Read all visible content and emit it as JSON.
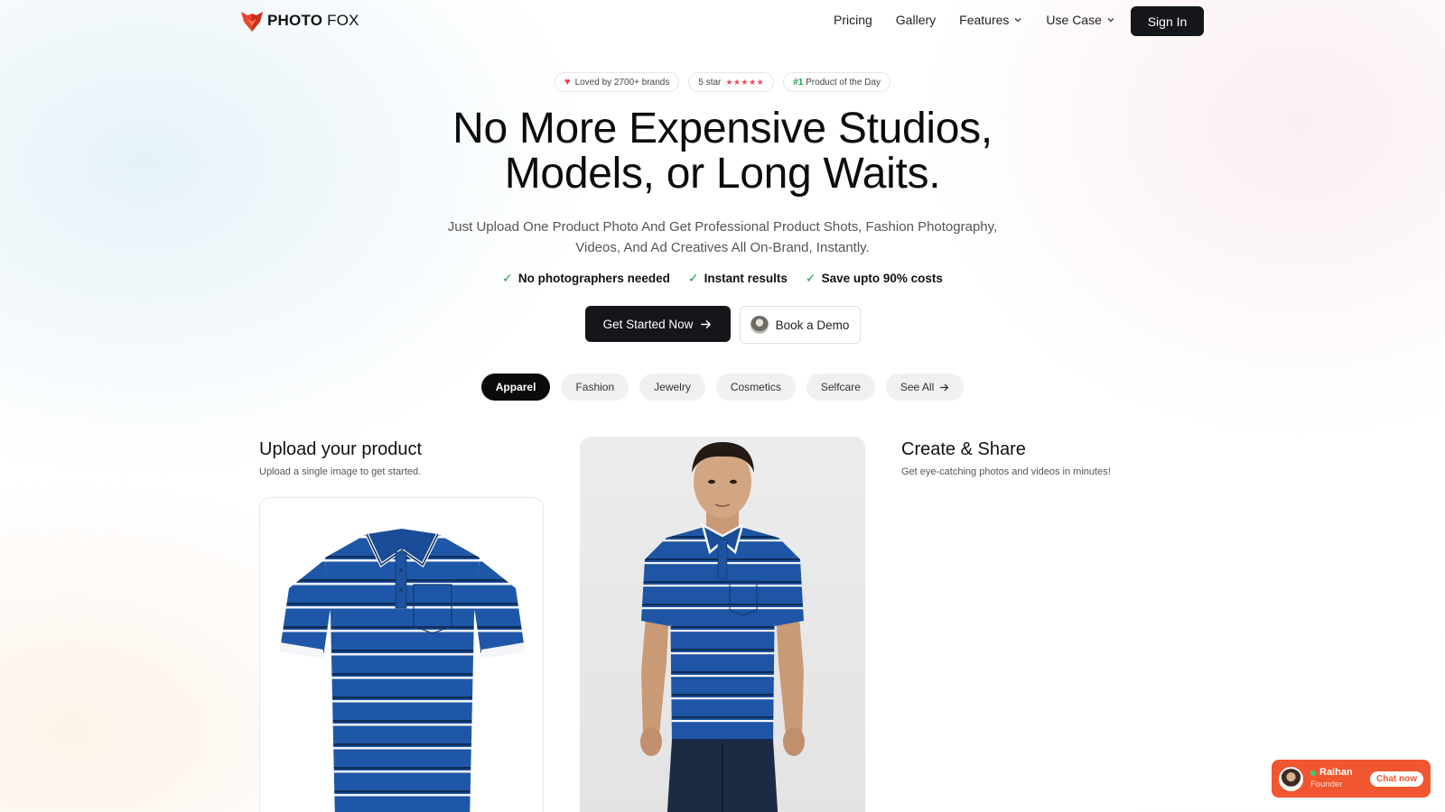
{
  "brand": {
    "name_bold": "PHOTO",
    "name_light": " FOX",
    "accent": "#e8452c"
  },
  "nav": {
    "links": [
      {
        "label": "Pricing"
      },
      {
        "label": "Gallery"
      },
      {
        "label": "Features"
      },
      {
        "label": "Use Case"
      }
    ],
    "signin_label": "Sign In"
  },
  "badges": {
    "loved": "Loved by 2700+ brands",
    "rating_text": "5 star",
    "stars": "★★★★★",
    "product_hash": "#1",
    "product_text": " Product of the Day"
  },
  "hero": {
    "headline_line1": "No More Expensive Studios,",
    "headline_line2": "Models, or Long Waits.",
    "subhead_line1": "Just Upload One Product Photo And Get Professional Product Shots, Fashion Photography,",
    "subhead_line2": "Videos, And Ad Creatives All On-Brand, Instantly.",
    "checks": [
      "No photographers needed",
      "Instant results",
      "Save upto 90% costs"
    ],
    "cta_primary": "Get Started Now",
    "cta_secondary": "Book a Demo"
  },
  "categories": {
    "items": [
      "Apparel",
      "Fashion",
      "Jewelry",
      "Cosmetics",
      "Selfcare"
    ],
    "active": "Apparel",
    "see_all": "See All"
  },
  "steps": {
    "upload_title": "Upload your product",
    "upload_sub": "Upload a single image to get started.",
    "share_title": "Create & Share",
    "share_sub": "Get eye-catching photos and videos in minutes!"
  },
  "chat_widget": {
    "name": "Raihan",
    "role": "Founder",
    "button": "Chat now",
    "color": "#f0562f"
  }
}
